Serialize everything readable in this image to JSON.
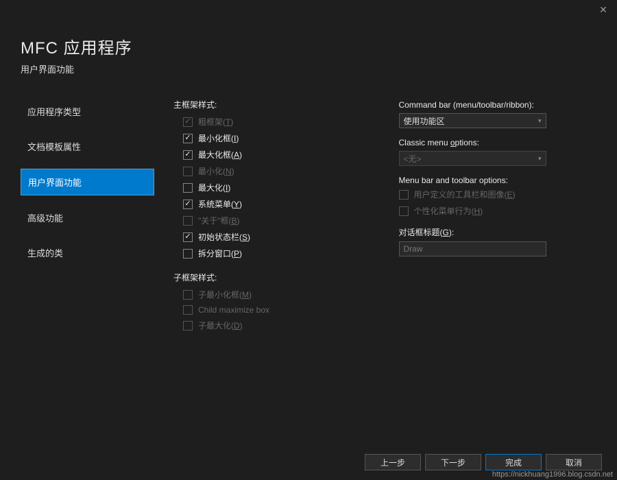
{
  "header": {
    "title": "MFC 应用程序",
    "subtitle": "用户界面功能"
  },
  "sidebar": {
    "items": [
      {
        "label": "应用程序类型"
      },
      {
        "label": "文档模板属性"
      },
      {
        "label": "用户界面功能"
      },
      {
        "label": "高级功能"
      },
      {
        "label": "生成的类"
      }
    ]
  },
  "left": {
    "mainFrameStylesLabel": "主框架样式:",
    "childFrameStylesLabel": "子框架样式:",
    "items": [
      {
        "label": "粗框架(T)",
        "checked": true,
        "disabled": true
      },
      {
        "label": "最小化框(I)",
        "checked": true,
        "disabled": false
      },
      {
        "label": "最大化框(A)",
        "checked": true,
        "disabled": false
      },
      {
        "label": "最小化(N)",
        "checked": false,
        "disabled": true
      },
      {
        "label": "最大化(I)",
        "checked": false,
        "disabled": false
      },
      {
        "label": "系统菜单(Y)",
        "checked": true,
        "disabled": false
      },
      {
        "label": "\"关于\"框(B)",
        "checked": false,
        "disabled": true
      },
      {
        "label": "初始状态栏(S)",
        "checked": true,
        "disabled": false
      },
      {
        "label": "拆分窗口(P)",
        "checked": false,
        "disabled": false
      }
    ],
    "childItems": [
      {
        "label": "子最小化框(M)",
        "checked": false,
        "disabled": true
      },
      {
        "label": "Child maximize box",
        "checked": false,
        "disabled": true
      },
      {
        "label": "子最大化(D)",
        "checked": false,
        "disabled": true
      }
    ]
  },
  "right": {
    "commandBarLabel": "Command bar (menu/toolbar/ribbon):",
    "commandBarValue": "使用功能区",
    "classicMenuLabel": "Classic menu options:",
    "classicMenuValue": "<无>",
    "toolbarOptionsLabel": "Menu bar and toolbar options:",
    "toolbarItems": [
      {
        "label": "用户定义的工具栏和图像(E)",
        "checked": false,
        "disabled": true
      },
      {
        "label": "个性化菜单行为(H)",
        "checked": false,
        "disabled": true
      }
    ],
    "dialogTitleLabel": "对话框标题(G):",
    "dialogTitleValue": "Draw"
  },
  "footer": {
    "prev": "上一步",
    "next": "下一步",
    "finish": "完成",
    "cancel": "取消"
  },
  "watermark": "https://nickhuang1996.blog.csdn.net"
}
